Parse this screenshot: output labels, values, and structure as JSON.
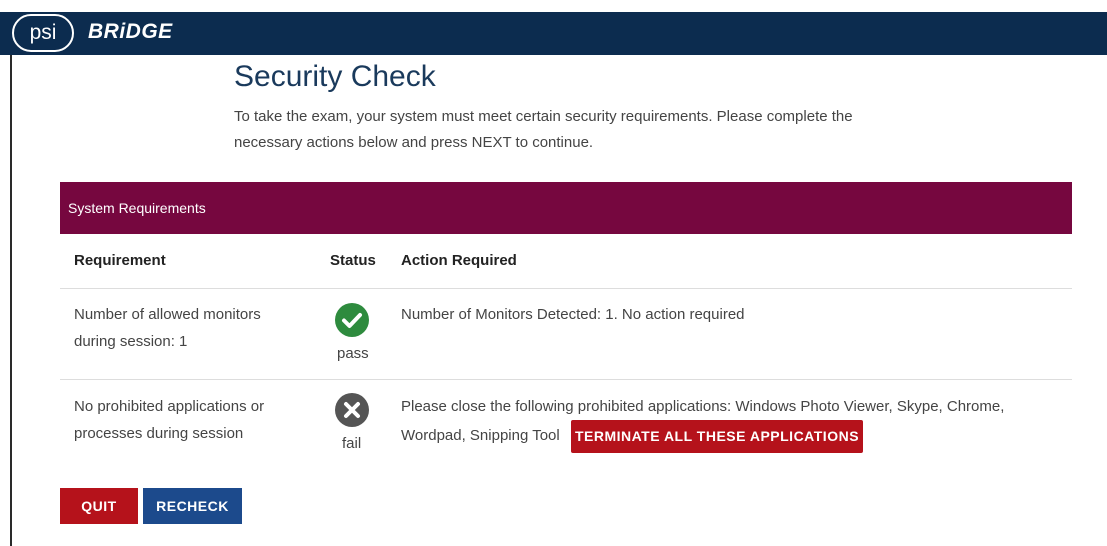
{
  "header": {
    "logo_psi": "psi",
    "logo_product": "BRiDGE"
  },
  "page": {
    "title": "Security Check",
    "intro_line1": "To take the exam, your system must meet certain security requirements. Please complete the",
    "intro_line2": "necessary actions below and press NEXT to continue."
  },
  "panel": {
    "title": "System Requirements"
  },
  "table": {
    "headers": {
      "requirement": "Requirement",
      "status": "Status",
      "action": "Action Required"
    },
    "rows": [
      {
        "requirement_line1": "Number of allowed monitors",
        "requirement_line2": "during session: 1",
        "status": "pass",
        "status_icon": "check-circle-icon",
        "status_color": "#2e8b3e",
        "action_line1": "Number of Monitors Detected: 1. No action required",
        "action_line2": ""
      },
      {
        "requirement_line1": "No prohibited applications or",
        "requirement_line2": "processes during session",
        "status": "fail",
        "status_icon": "x-circle-icon",
        "status_color": "#555555",
        "action_line1": "Please close the following prohibited applications: Windows Photo Viewer, Skype, Chrome,",
        "action_line2": "Wordpad, Snipping Tool",
        "action_button": "TERMINATE ALL THESE APPLICATIONS"
      }
    ]
  },
  "buttons": {
    "quit": "QUIT",
    "recheck": "RECHECK"
  },
  "colors": {
    "header_bg": "#0c2c4f",
    "panel_bg": "#76073f",
    "danger": "#b5121b",
    "primary": "#1c4a8c"
  }
}
